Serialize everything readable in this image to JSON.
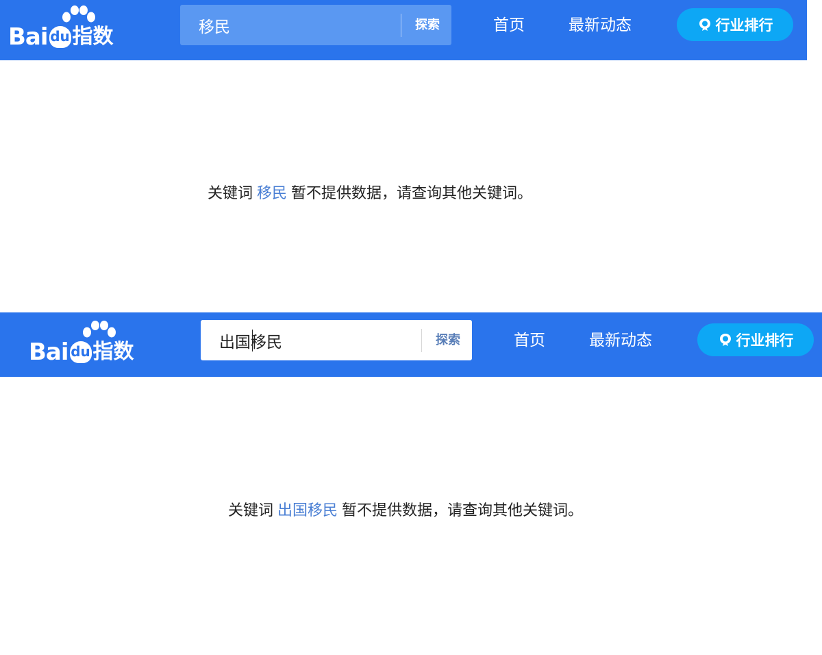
{
  "brand": {
    "bai": "Bai",
    "du": "du",
    "zhishu": "指数",
    "color": "#2a74ec"
  },
  "nav": {
    "search_button": "探索",
    "home": "首页",
    "news": "最新动态",
    "rank_button": "行业排行",
    "accent": "#0da7f5"
  },
  "panels": [
    {
      "search_value": "移民",
      "message_prefix": "关键词",
      "keyword": "移民",
      "message_suffix": "暂不提供数据，请查询其他关键词。"
    },
    {
      "search_value": "出国移民",
      "message_prefix": "关键词",
      "keyword": "出国移民",
      "message_suffix": "暂不提供数据，请查询其他关键词。"
    }
  ],
  "icons": {
    "logo_paw": "paw-icon",
    "rank": "ranking-badge-icon"
  }
}
